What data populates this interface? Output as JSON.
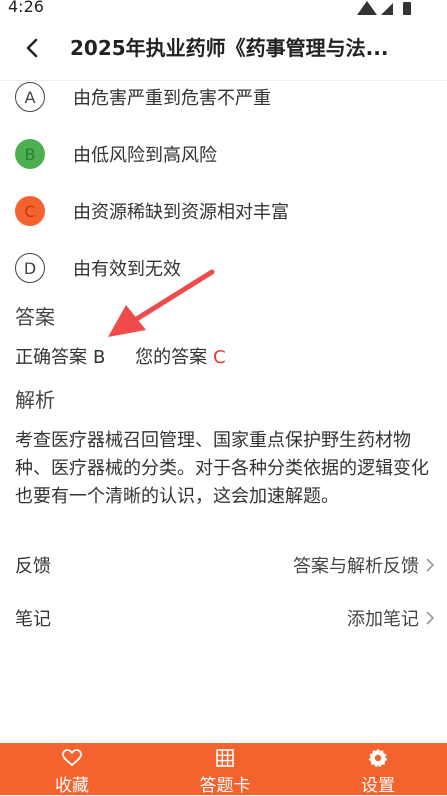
{
  "colors": {
    "accent": "#F4622D",
    "option_b": "#4CAF50",
    "option_c": "#F4622D",
    "your_answer": "#E53935",
    "arrow": "#EF4B4B"
  },
  "status_bar": {
    "time": "4:26"
  },
  "header": {
    "title": "2025年执业药师《药事管理与法..."
  },
  "options": [
    {
      "letter": "A",
      "text": "由危害严重到危害不严重",
      "state": "plain"
    },
    {
      "letter": "B",
      "text": "由低风险到高风险",
      "state": "correct"
    },
    {
      "letter": "C",
      "text": "由资源稀缺到资源相对丰富",
      "state": "wrong"
    },
    {
      "letter": "D",
      "text": "由有效到无效",
      "state": "plain"
    }
  ],
  "answer": {
    "section_title": "答案",
    "correct_label": "正确答案",
    "correct_value": "B",
    "yours_label": "您的答案",
    "yours_value": "C"
  },
  "analysis": {
    "section_title": "解析",
    "text": "考查医疗器械召回管理、国家重点保护野生药材物种、医疗器械的分类。对于各种分类依据的逻辑变化也要有一个清晰的认识，这会加速解题。"
  },
  "feedback": {
    "label": "反馈",
    "action": "答案与解析反馈"
  },
  "notes": {
    "label": "笔记",
    "action": "添加笔记"
  },
  "bottom_bar": {
    "favorite": "收藏",
    "answer_sheet": "答题卡",
    "settings": "设置"
  }
}
